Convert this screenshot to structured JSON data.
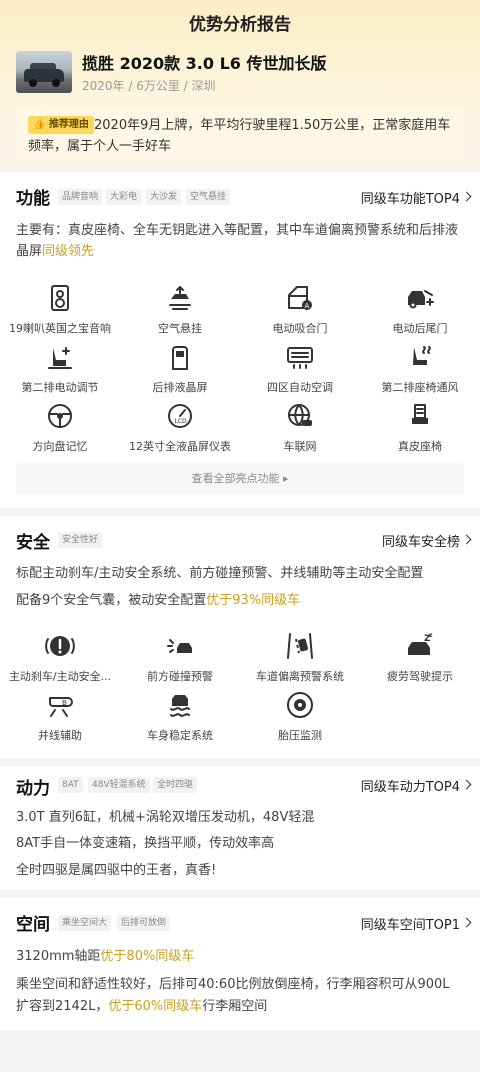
{
  "page_title": "优势分析报告",
  "car": {
    "name": "揽胜 2020款 3.0 L6 传世加长版",
    "meta": "2020年 / 6万公里 / 深圳"
  },
  "recommend": {
    "tag": "推荐理由",
    "text": "2020年9月上牌，年平均行驶里程1.50万公里，正常家庭用车频率，属于个人一手好车"
  },
  "function": {
    "title": "功能",
    "tags": [
      "品牌音响",
      "大彩电",
      "大沙发",
      "空气悬挂"
    ],
    "rank": "同级车功能TOP4",
    "desc_prefix": "主要有：真皮座椅、全车无钥匙进入等配置，其中车道偏离预警系统和后排液晶屏",
    "desc_highlight": "同级领先",
    "features": [
      {
        "label": "19喇叭英国之宝音响",
        "icon": "speaker-icon"
      },
      {
        "label": "空气悬挂",
        "icon": "air-suspension-icon"
      },
      {
        "label": "电动吸合门",
        "icon": "soft-close-door-icon"
      },
      {
        "label": "电动后尾门",
        "icon": "power-tailgate-icon"
      },
      {
        "label": "第二排电动调节",
        "icon": "seat-adjust-icon"
      },
      {
        "label": "后排液晶屏",
        "icon": "rear-screen-icon"
      },
      {
        "label": "四区自动空调",
        "icon": "climate-icon"
      },
      {
        "label": "第二排座椅通风",
        "icon": "seat-vent-icon"
      },
      {
        "label": "方向盘记忆",
        "icon": "steering-wheel-icon"
      },
      {
        "label": "12英寸全液晶屏仪表",
        "icon": "lcd-cluster-icon"
      },
      {
        "label": "车联网",
        "icon": "connected-car-icon"
      },
      {
        "label": "真皮座椅",
        "icon": "leather-seat-icon"
      }
    ],
    "view_all": "查看全部亮点功能"
  },
  "safety": {
    "title": "安全",
    "tags": [
      "安全性好"
    ],
    "rank": "同级车安全榜",
    "line1": "标配主动刹车/主动安全系统、前方碰撞预警、并线辅助等主动安全配置",
    "line2_prefix": "配备9个安全气囊，被动安全配置",
    "line2_highlight": "优于93%同级车",
    "features": [
      {
        "label": "主动刹车/主动安全...",
        "icon": "brake-warning-icon"
      },
      {
        "label": "前方碰撞预警",
        "icon": "collision-warning-icon"
      },
      {
        "label": "车道偏离预警系统",
        "icon": "lane-departure-icon"
      },
      {
        "label": "疲劳驾驶提示",
        "icon": "fatigue-icon"
      },
      {
        "label": "并线辅助",
        "icon": "blind-spot-icon"
      },
      {
        "label": "车身稳定系统",
        "icon": "stability-icon"
      },
      {
        "label": "胎压监测",
        "icon": "tire-pressure-icon"
      }
    ]
  },
  "power": {
    "title": "动力",
    "tags": [
      "8AT",
      "48V轻混系统",
      "全时四驱"
    ],
    "rank": "同级车动力TOP4",
    "lines": [
      "3.0T 直列6缸，机械+涡轮双增压发动机，48V轻混",
      "8AT手自一体变速箱，换挡平顺，传动效率高",
      "全时四驱是属四驱中的王者，真香!"
    ]
  },
  "space": {
    "title": "空间",
    "tags": [
      "乘坐空间大",
      "后排可放倒"
    ],
    "rank": "同级车空间TOP1",
    "line1_prefix": "3120mm轴距",
    "line1_highlight": "优于80%同级车",
    "line2": "乘坐空间和舒适性较好，后排可40:60比例放倒座椅，行李厢容积可从900L",
    "line3_prefix": "扩容到2142L，",
    "line3_highlight": "优于60%同级车",
    "line3_suffix": "行李厢空间"
  },
  "colors": {
    "accent": "#c9a222",
    "tag_yellow": "#fbd85a"
  }
}
